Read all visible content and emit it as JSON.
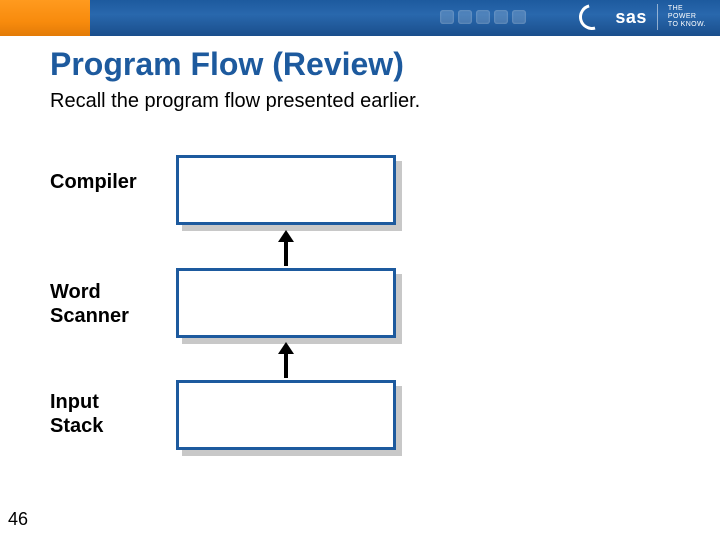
{
  "banner": {
    "brand": "sas",
    "tagline_line1": "THE",
    "tagline_line2": "POWER",
    "tagline_line3": "TO KNOW."
  },
  "title": "Program Flow (Review)",
  "subtitle": "Recall the program flow presented earlier.",
  "labels": {
    "compiler": "Compiler",
    "word_scanner_l1": "Word",
    "word_scanner_l2": "Scanner",
    "input_stack_l1": "Input",
    "input_stack_l2": "Stack"
  },
  "page_number": "46"
}
